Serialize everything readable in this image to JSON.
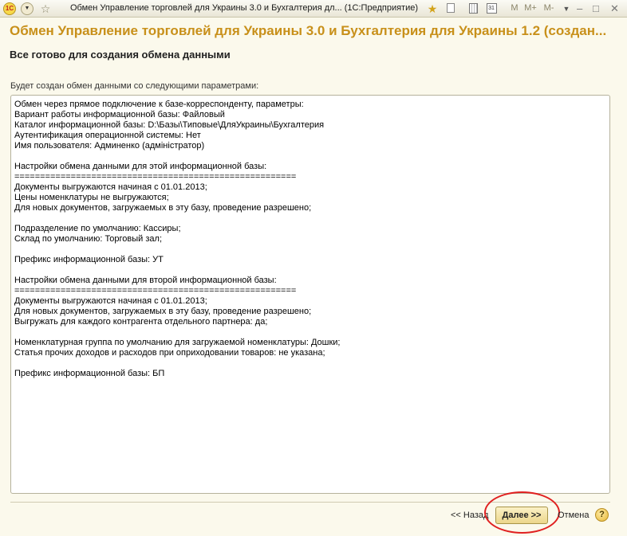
{
  "window": {
    "title": "Обмен Управление торговлей для Украины 3.0 и Бухгалтерия дл...  (1С:Предприятие)",
    "logo_text": "1С",
    "calendar_text": "31",
    "m_buttons": [
      "M",
      "M+",
      "M-"
    ],
    "close_symbol": "✕",
    "menu_symbol": "▼"
  },
  "form": {
    "title": "Обмен Управление торговлей для Украины 3.0 и Бухгалтерия для Украины 1.2 (создан...",
    "subheader": "Все готово для создания обмена данными",
    "params_label": "Будет создан обмен данными со следующими параметрами:",
    "lines": [
      "Обмен через прямое подключение к базе-корреспонденту, параметры:",
      "Вариант работы информационной базы: Файловый",
      "Каталог информационной базы: D:\\Базы\\Типовые\\ДляУкраины\\Бухгалтерия",
      "Аутентификация операционной системы: Нет",
      "Имя пользователя: Админенко (адміністратор)",
      "",
      "Настройки обмена данными для этой информационной базы:",
      "=======================================================",
      "Документы выгружаются начиная с 01.01.2013;",
      "Цены номенклатуры не выгружаются;",
      "Для новых документов, загружаемых в эту базу, проведение разрешено;",
      "",
      "Подразделение по умолчанию: Кассиры;",
      "Склад по умолчанию: Торговый зал;",
      "",
      "Префикс информационной базы: УТ",
      "",
      "Настройки обмена данными для второй информационной базы:",
      "=======================================================",
      "Документы выгружаются начиная с 01.01.2013;",
      "Для новых документов, загружаемых в эту базу, проведение разрешено;",
      "Выгружать для каждого контрагента отдельного партнера: да;",
      "",
      "Номенклатурная группа по умолчанию для загружаемой номенклатуры: Дошки;",
      "Статья прочих доходов и расходов при оприходовании товаров: не указана;",
      "",
      "Префикс информационной базы: БП"
    ]
  },
  "footer": {
    "back_label": "<< Назад",
    "next_label": "Далее >>",
    "cancel_label": "Отмена",
    "help_label": "?"
  },
  "colors": {
    "title_accent": "#c8901a",
    "highlight_ring": "#e02020"
  }
}
